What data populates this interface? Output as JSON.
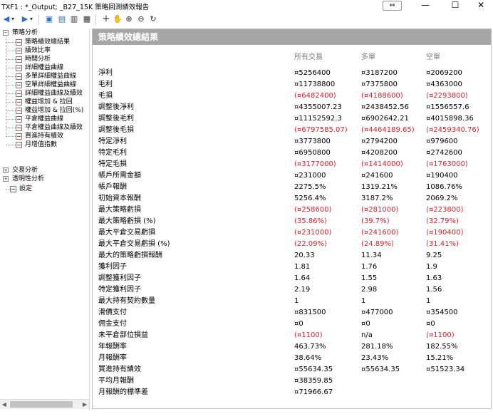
{
  "window": {
    "title": "TXF1 : *_Output; _B27_15K 策略回測績效報告",
    "swap_glyph": "⇔",
    "minimize_glyph": "—",
    "maximize_glyph": "☐",
    "close_glyph": "✕"
  },
  "toolbar": {
    "back_glyph": "◀",
    "forward_glyph": "▶",
    "dropdown_glyph": "▾",
    "save_glyph": "▣",
    "print_preview_glyph": "▤",
    "print_glyph": "▥",
    "doc_glyph": "▦",
    "pointer_glyph": "+",
    "pan_glyph": "✋",
    "zoom_in_glyph": "⊕",
    "zoom_out_glyph": "⊖",
    "refresh_glyph": "↻"
  },
  "tree": {
    "collapse_glyph": "−",
    "expand_glyph": "+",
    "root": "策略分析",
    "children": [
      "策略績效總結果",
      "績效比率",
      "時間分析",
      "詳細權益曲線",
      "多單詳細權益曲線",
      "空單詳細權益曲線",
      "詳細權益曲線及績效",
      "權益增加 & 拉回",
      "權益增加 & 拉回(%)",
      "平倉權益曲線",
      "平倉權益曲線及績效",
      "買進持有績效",
      "月增值指數"
    ],
    "other_roots": [
      "交易分析",
      "透明性分析"
    ],
    "settings": "設定"
  },
  "report": {
    "title": "策略績效總結果",
    "columns": [
      "所有交易",
      "多單",
      "空單"
    ],
    "rows": [
      {
        "label": "淨利",
        "all": "¤5256400",
        "long": "¤3187200",
        "short": "¤2069200",
        "neg": false
      },
      {
        "label": "毛利",
        "all": "¤11738800",
        "long": "¤7375800",
        "short": "¤4363000",
        "neg": false
      },
      {
        "label": "毛損",
        "all": "(¤6482400)",
        "long": "(¤4188600)",
        "short": "(¤2293800)",
        "neg": true
      },
      {
        "label": "調整後淨利",
        "all": "¤4355007.23",
        "long": "¤2438452.56",
        "short": "¤1556557.6",
        "neg": false
      },
      {
        "label": "調整後毛利",
        "all": "¤11152592.3",
        "long": "¤6902642.21",
        "short": "¤4015898.36",
        "neg": false
      },
      {
        "label": "調整後毛損",
        "all": "(¤6797585.07)",
        "long": "(¤4464189.65)",
        "short": "(¤2459340.76)",
        "neg": true
      },
      {
        "label": "特定淨利",
        "all": "¤3773800",
        "long": "¤2794200",
        "short": "¤979600",
        "neg": false
      },
      {
        "label": "特定毛利",
        "all": "¤6950800",
        "long": "¤4208200",
        "short": "¤2742600",
        "neg": false
      },
      {
        "label": "特定毛損",
        "all": "(¤3177000)",
        "long": "(¤1414000)",
        "short": "(¤1763000)",
        "neg": true
      },
      {
        "label": "帳戶所需金額",
        "all": "¤231000",
        "long": "¤241600",
        "short": "¤190400",
        "neg": false
      },
      {
        "label": "帳戶報酬",
        "all": "2275.5%",
        "long": "1319.21%",
        "short": "1086.76%",
        "neg": false
      },
      {
        "label": "初始資本報酬",
        "all": "5256.4%",
        "long": "3187.2%",
        "short": "2069.2%",
        "neg": false
      },
      {
        "label": "最大策略虧損",
        "all": "(¤258600)",
        "long": "(¤281000)",
        "short": "(¤223800)",
        "neg": true
      },
      {
        "label": "最大策略虧損 (%)",
        "all": "(35.86%)",
        "long": "(39.7%)",
        "short": "(32.79%)",
        "neg": true
      },
      {
        "label": "最大平倉交易虧損",
        "all": "(¤231000)",
        "long": "(¤241600)",
        "short": "(¤190400)",
        "neg": true
      },
      {
        "label": "最大平倉交易虧損 (%)",
        "all": "(22.09%)",
        "long": "(24.89%)",
        "short": "(31.41%)",
        "neg": true
      },
      {
        "label": "最大的策略虧損報酬",
        "all": "20.33",
        "long": "11.34",
        "short": "9.25",
        "neg": false
      },
      {
        "label": "獲利因子",
        "all": "1.81",
        "long": "1.76",
        "short": "1.9",
        "neg": false
      },
      {
        "label": "調整獲利因子",
        "all": "1.64",
        "long": "1.55",
        "short": "1.63",
        "neg": false
      },
      {
        "label": "特定獲利因子",
        "all": "2.19",
        "long": "2.98",
        "short": "1.56",
        "neg": false
      },
      {
        "label": "最大持有契約數量",
        "all": "1",
        "long": "1",
        "short": "1",
        "neg": false
      },
      {
        "label": "滑價支付",
        "all": "¤831500",
        "long": "¤477000",
        "short": "¤354500",
        "neg": false
      },
      {
        "label": "佣金支付",
        "all": "¤0",
        "long": "¤0",
        "short": "¤0",
        "neg": false
      },
      {
        "label": "未平倉部位損益",
        "all": "(¤1100)",
        "long": "n/a",
        "short": "(¤1100)",
        "neg": true
      },
      {
        "label": "年報酬率",
        "all": "463.73%",
        "long": "281.18%",
        "short": "182.55%",
        "neg": false
      },
      {
        "label": "月報酬率",
        "all": "38.64%",
        "long": "23.43%",
        "short": "15.21%",
        "neg": false
      },
      {
        "label": "買進持有績效",
        "all": "¤55634.35",
        "long": "¤55634.35",
        "short": "¤51523.34",
        "neg": false
      },
      {
        "label": "平均月報酬",
        "all": "¤38359.85",
        "long": "",
        "short": "",
        "neg": false
      },
      {
        "label": "月報酬的標準差",
        "all": "¤71966.67",
        "long": "",
        "short": "",
        "neg": false
      }
    ]
  },
  "scrollbar": {
    "left_glyph": "◀",
    "right_glyph": "▶"
  },
  "colors": {
    "negative": "#d9232e",
    "header_bg": "#a6a6a6",
    "column_head": "#808080"
  }
}
